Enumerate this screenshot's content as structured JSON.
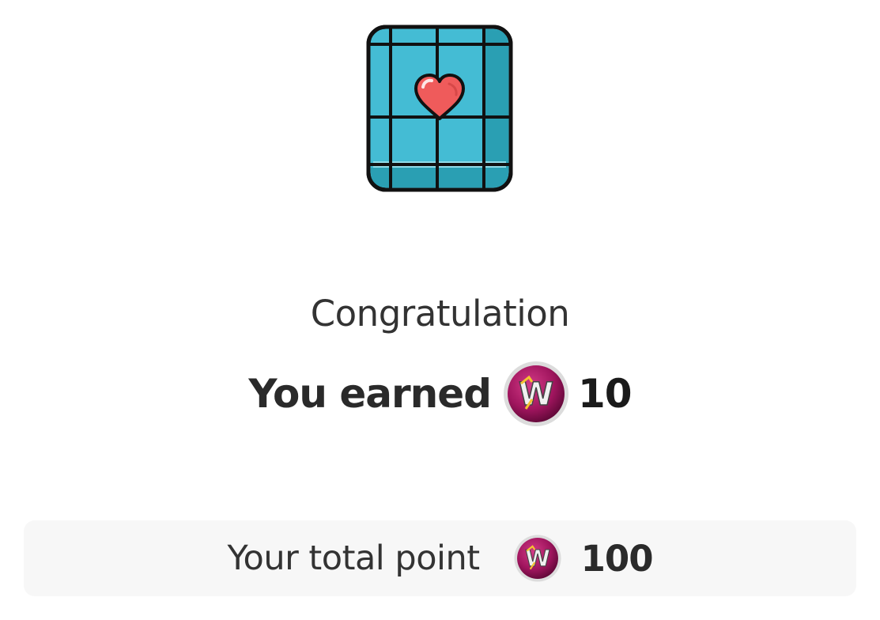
{
  "reward": {
    "illustration_icon": "card-heart-icon",
    "title": "Congratulation",
    "earned_label": "You earned",
    "earned_value": "10",
    "coin_icon": "w-coin-icon"
  },
  "total": {
    "label": "Your total point",
    "value": "100"
  },
  "colors": {
    "card_blue": "#44bcd4",
    "heart": "#ef5b5b",
    "coin_magenta": "#a0155e",
    "total_bg": "#f7f7f7"
  }
}
